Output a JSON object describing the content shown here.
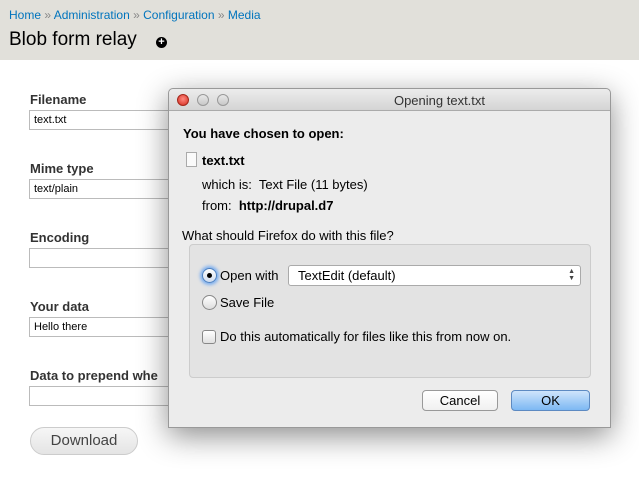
{
  "breadcrumb": {
    "home": "Home",
    "administration": "Administration",
    "configuration": "Configuration",
    "media": "Media",
    "separator": "»"
  },
  "page_title": "Blob form relay",
  "form": {
    "filename_label": "Filename",
    "filename_value": "text.txt",
    "mime_label": "Mime type",
    "mime_value": "text/plain",
    "encoding_label": "Encoding",
    "encoding_value": "",
    "data_label": "Your data",
    "data_value": "Hello there",
    "prepend_label": "Data to prepend whe",
    "prepend_value": "",
    "download_button": "Download"
  },
  "dialog": {
    "title": "Opening text.txt",
    "heading": "You have chosen to open:",
    "filename": "text.txt",
    "which_is_label": "which is:",
    "which_is_value": "Text File (11 bytes)",
    "from_label": "from:",
    "from_value": "http://drupal.d7",
    "question": "What should Firefox do with this file?",
    "open_with_label": "Open with",
    "open_with_app": "TextEdit (default)",
    "save_file_label": "Save File",
    "auto_label": "Do this automatically for files like this from now on.",
    "cancel_button": "Cancel",
    "ok_button": "OK"
  }
}
